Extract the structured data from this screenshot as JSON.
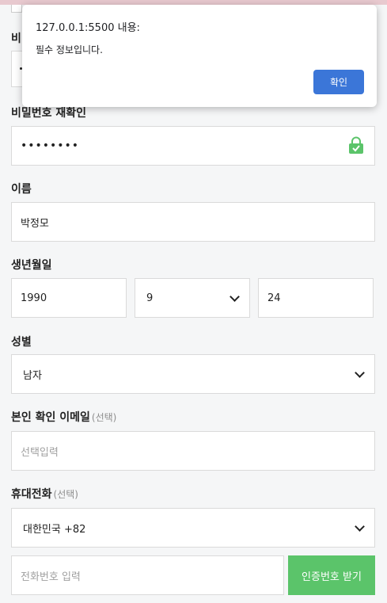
{
  "dialog": {
    "title": "127.0.0.1:5500 내용:",
    "message": "필수 정보입니다.",
    "ok_label": "확인"
  },
  "partial_label": "비",
  "password_confirm": {
    "label": "비밀번호 재확인",
    "value": "••••••••",
    "icon": "lock-icon",
    "icon_color": "#5bc46a"
  },
  "name": {
    "label": "이름",
    "value": "박정모"
  },
  "birth": {
    "label": "생년월일",
    "year": "1990",
    "month": "9",
    "day": "24"
  },
  "gender": {
    "label": "성별",
    "value": "남자"
  },
  "email": {
    "label": "본인 확인 이메일",
    "optional": "(선택)",
    "placeholder": "선택입력"
  },
  "phone": {
    "label": "휴대전화",
    "optional": "(선택)",
    "country": "대한민국 +82",
    "placeholder": "전화번호 입력",
    "verify_button": "인증번호 받기"
  },
  "colors": {
    "accent_green": "#5bc46a",
    "dialog_button": "#3b76d8"
  }
}
